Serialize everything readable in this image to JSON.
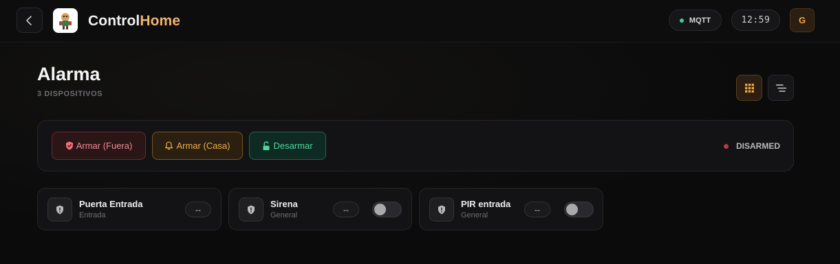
{
  "header": {
    "title_main": "Control",
    "title_accent": "Home",
    "mqtt_label": "MQTT",
    "mqtt_status_color": "#34d399",
    "clock": "12:59",
    "avatar_initial": "G",
    "back_icon": "chevron-left-icon",
    "logo_icon": "app-logo-icon"
  },
  "page": {
    "title": "Alarma",
    "subtitle": "3 DISPOSITIVOS",
    "view_modes": [
      {
        "icon": "grid-icon",
        "active": true
      },
      {
        "icon": "list-icon",
        "active": false
      }
    ]
  },
  "alarm_panel": {
    "actions": [
      {
        "label": "Armar (Fuera)",
        "icon": "shield-icon",
        "color": "#f08a92"
      },
      {
        "label": "Armar (Casa)",
        "icon": "bell-icon",
        "color": "#f2b04c"
      },
      {
        "label": "Desarmar",
        "icon": "unlock-icon",
        "color": "#4fd6a0"
      }
    ],
    "status": "DISARMED",
    "status_color": "#b83a48"
  },
  "devices": [
    {
      "name": "Puerta Entrada",
      "room": "Entrada",
      "value": "--",
      "icon": "shield-alert-icon",
      "has_toggle": false
    },
    {
      "name": "Sirena",
      "room": "General",
      "value": "--",
      "icon": "shield-alert-icon",
      "has_toggle": true,
      "toggle_on": false
    },
    {
      "name": "PIR entrada",
      "room": "General",
      "value": "--",
      "icon": "shield-alert-icon",
      "has_toggle": true,
      "toggle_on": false
    }
  ]
}
